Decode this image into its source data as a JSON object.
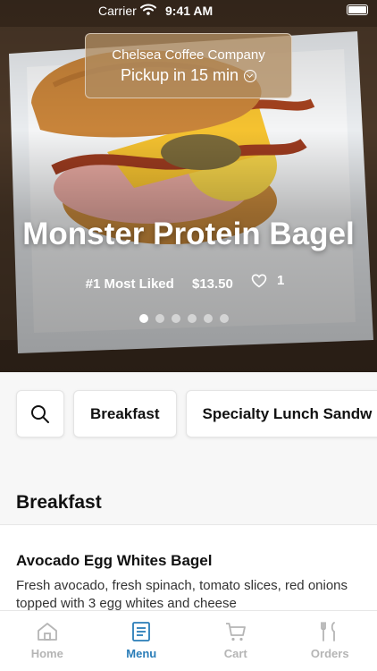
{
  "status_bar": {
    "carrier": "Carrier",
    "time": "9:41 AM"
  },
  "pickup": {
    "location": "Chelsea Coffee Company",
    "eta": "Pickup in 15 min"
  },
  "hero": {
    "title": "Monster Protein Bagel",
    "rank": "#1 Most Liked",
    "price": "$13.50",
    "likes": "1",
    "carousel": {
      "total": 6,
      "active": 0
    }
  },
  "categories": [
    "Breakfast",
    "Specialty Lunch Sandw"
  ],
  "section_title": "Breakfast",
  "item": {
    "name": "Avocado Egg Whites Bagel",
    "description": "Fresh avocado, fresh spinach, tomato slices, red onions topped with 3 egg whites and cheese"
  },
  "tabs": [
    {
      "label": "Home",
      "icon": "home-icon",
      "active": false
    },
    {
      "label": "Menu",
      "icon": "menu-icon",
      "active": true
    },
    {
      "label": "Cart",
      "icon": "cart-icon",
      "active": false
    },
    {
      "label": "Orders",
      "icon": "orders-icon",
      "active": false
    }
  ],
  "colors": {
    "accent": "#2a7db8",
    "inactive": "#b5b5b5"
  }
}
